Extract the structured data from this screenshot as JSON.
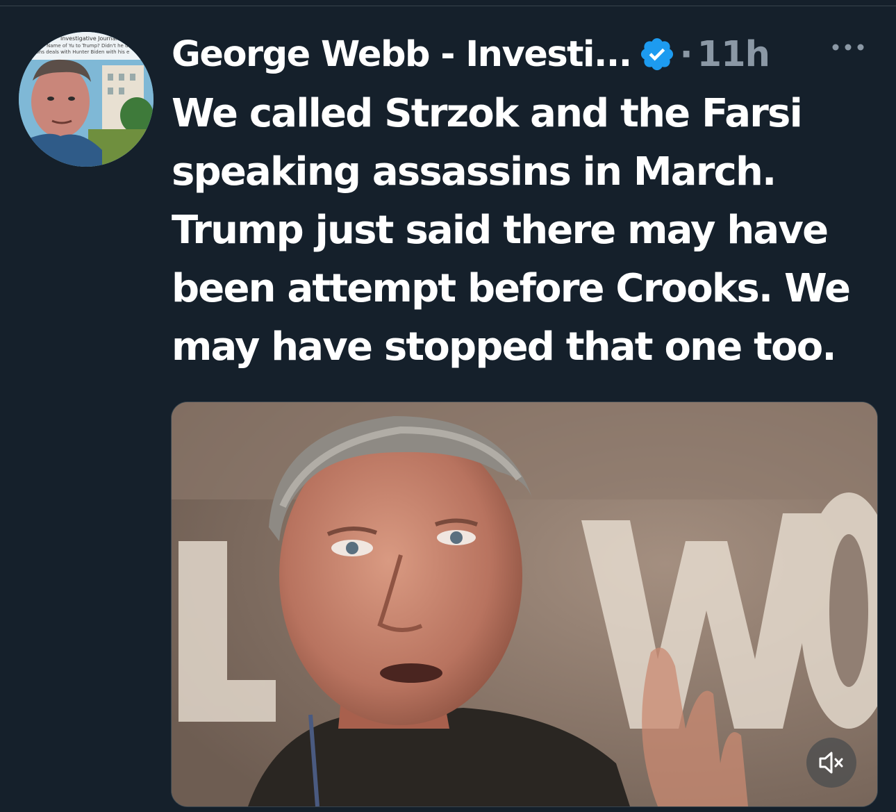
{
  "tweet": {
    "author_name": "George Webb - Investi...",
    "verified": true,
    "separator": "·",
    "timestamp": "11h",
    "more_label": "···",
    "text_lines": [
      "We called Strzok and the Farsi",
      "speaking assassins in March.",
      "Trump just said there may have",
      "been attempt before Crooks. We",
      "may have stopped that one too."
    ]
  },
  "avatar": {
    "banner_lines": [
      "Investigative Journalist",
      "Name of Yu to Trump?  Didn't he d",
      "tions deals with Hunter Biden with his e"
    ]
  },
  "media": {
    "type": "video",
    "background_sign_letters": "L W O",
    "muted": true,
    "mute_icon": "speaker-muted-icon"
  },
  "colors": {
    "background": "#15202b",
    "text_primary": "#ffffff",
    "text_secondary": "#8b98a5",
    "verified_badge": "#1d9bf0",
    "divider": "#38444d"
  }
}
